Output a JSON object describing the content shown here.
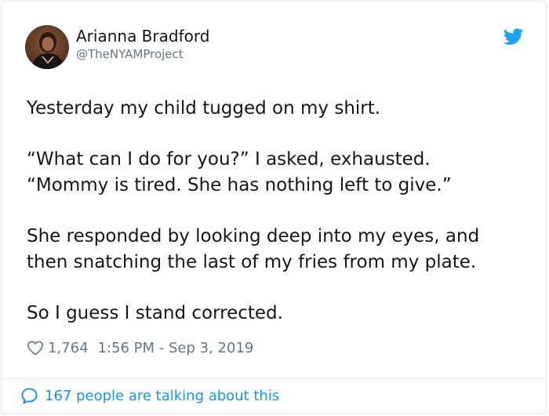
{
  "author": {
    "display_name": "Arianna Bradford",
    "handle": "@TheNYAMProject",
    "avatar_icon": "profile-photo"
  },
  "tweet": {
    "lines": [
      "Yesterday my child tugged on my shirt.",
      "“What can I do for you?” I asked, exhausted.",
      "“Mommy is tired. She has nothing left to give.”",
      "She responded by looking deep into my eyes, and",
      "then snatching the last of my fries from my plate.",
      "So I guess I stand corrected."
    ]
  },
  "meta": {
    "likes": "1,764",
    "timestamp": "1:56 PM - Sep 3, 2019"
  },
  "footer": {
    "conversation_text": "167 people are talking about this"
  },
  "colors": {
    "twitter_blue": "#1da1f2",
    "link_blue": "#1b95e0",
    "muted_gray": "#657786",
    "text_dark": "#14171a",
    "border": "#e1e8ed"
  },
  "icons": {
    "brand": "twitter-bird-icon",
    "like": "heart-icon",
    "conversation": "speech-bubble-icon"
  }
}
